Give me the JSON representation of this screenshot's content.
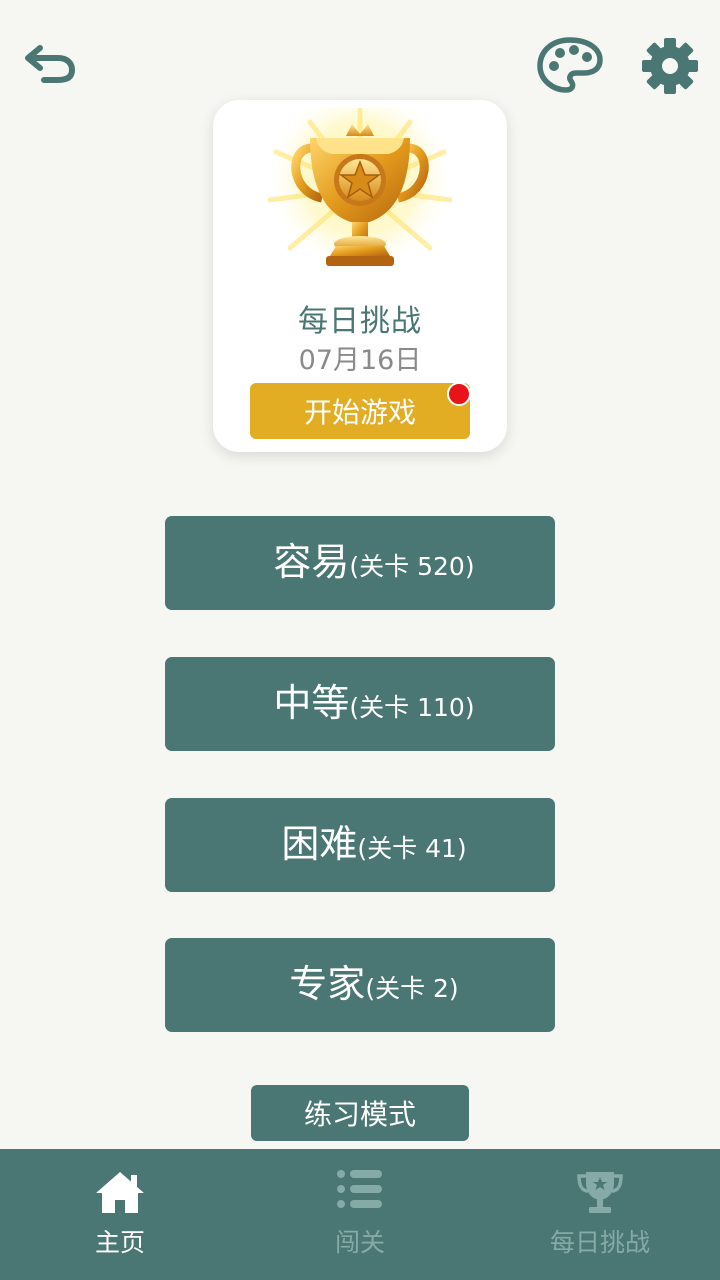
{
  "colors": {
    "primary": "#4a7774",
    "accent": "#e2ac23",
    "background": "#f6f6f2",
    "notification": "#e8141a",
    "nav_inactive": "#85aaa7"
  },
  "header": {
    "icons": [
      "back-icon",
      "palette-icon",
      "gear-icon"
    ]
  },
  "daily_card": {
    "icon": "trophy-icon",
    "title": "每日挑战",
    "date": "07月16日",
    "start_label": "开始游戏",
    "has_notification": true
  },
  "levels": [
    {
      "name": "容易",
      "count": "(关卡 520)"
    },
    {
      "name": "中等",
      "count": "(关卡 110)"
    },
    {
      "name": "困难",
      "count": "(关卡 41)"
    },
    {
      "name": "专家",
      "count": "(关卡 2)"
    }
  ],
  "practice_label": "练习模式",
  "bottom_nav": [
    {
      "icon": "home-icon",
      "label": "主页",
      "active": true
    },
    {
      "icon": "list-icon",
      "label": "闯关",
      "active": false
    },
    {
      "icon": "trophy-icon",
      "label": "每日挑战",
      "active": false
    }
  ]
}
